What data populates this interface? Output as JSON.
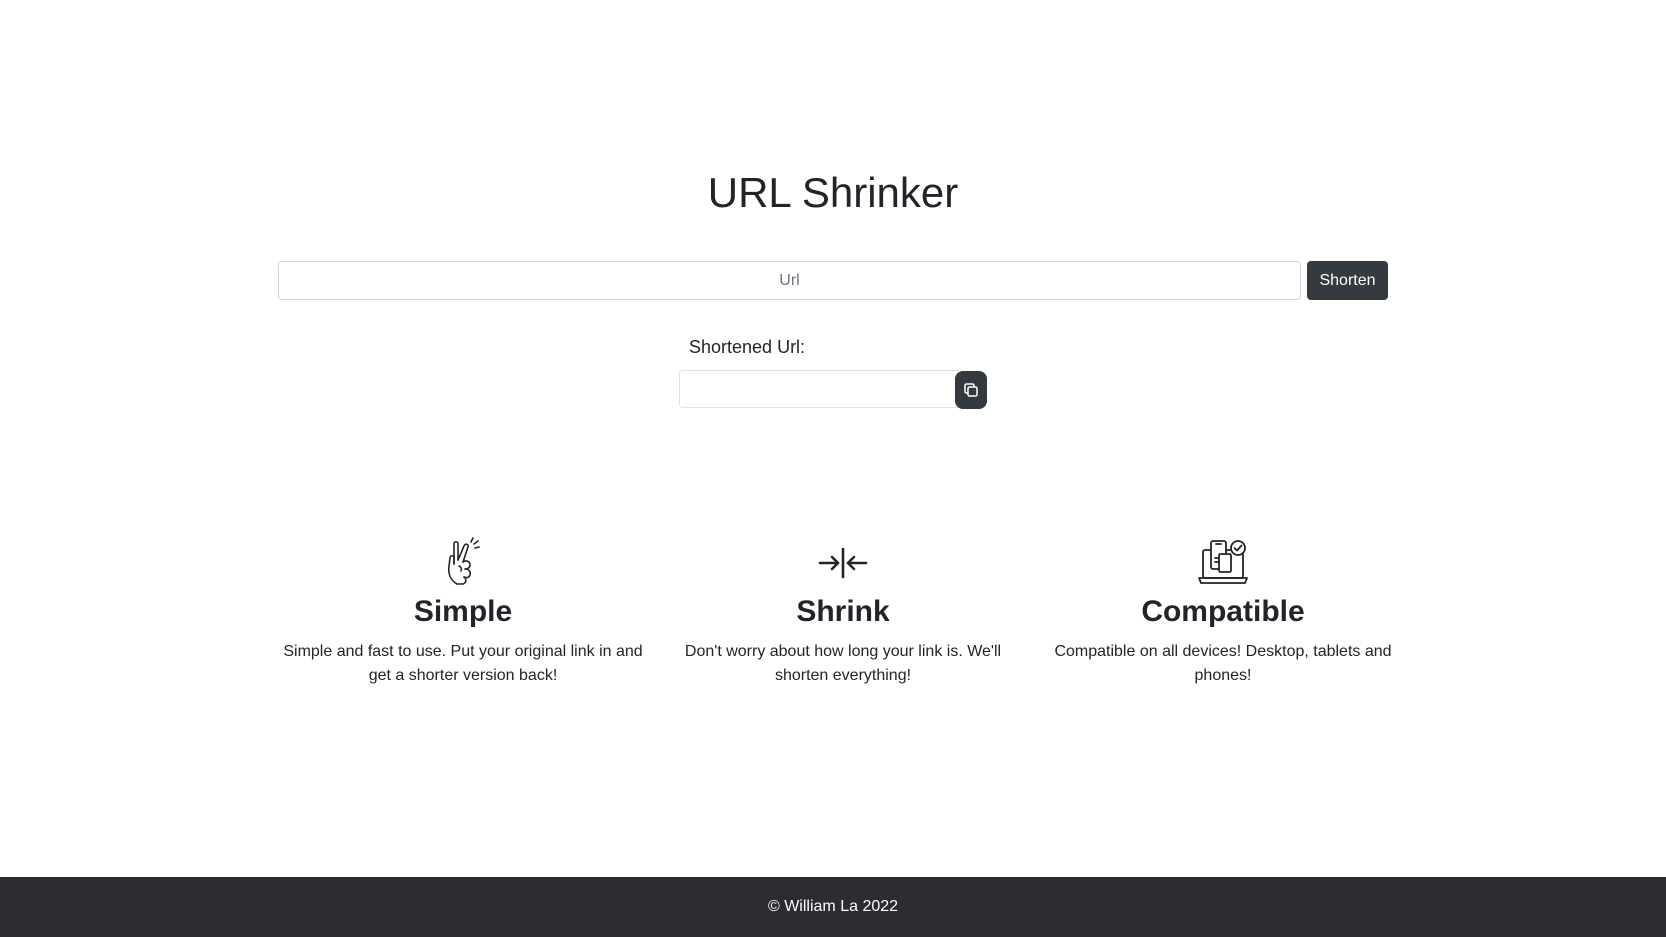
{
  "header": {
    "title": "URL Shrinker"
  },
  "form": {
    "url_placeholder": "Url",
    "url_value": "",
    "shorten_label": "Shorten"
  },
  "result": {
    "label": "Shortened Url:",
    "value": "",
    "copy_icon": "copy-icon"
  },
  "features": [
    {
      "icon": "fingers-crossed-icon",
      "title": "Simple",
      "text": "Simple and fast to use. Put your original link in and get a shorter version back!"
    },
    {
      "icon": "shrink-arrows-icon",
      "title": "Shrink",
      "text": "Don't worry about how long your link is. We'll shorten everything!"
    },
    {
      "icon": "devices-icon",
      "title": "Compatible",
      "text": "Compatible on all devices! Desktop, tablets and phones!"
    }
  ],
  "footer": {
    "text": "© William La 2022"
  },
  "colors": {
    "button_dark": "#343a40",
    "footer_bg": "#2b2d31",
    "text": "#212529"
  }
}
